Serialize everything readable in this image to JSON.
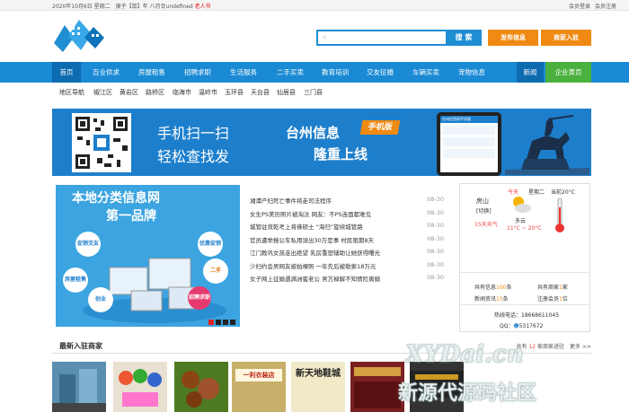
{
  "topbar": {
    "date": "2020年10月6日 星期二　庚子【鼠】年 八月廿undefined",
    "festival": "老人节",
    "login": "会员登录",
    "register": "会员注册"
  },
  "search": {
    "button": "搜 索",
    "placeholder": ""
  },
  "header_buttons": {
    "publish": "发布信息",
    "merchant": "商家入驻"
  },
  "nav": {
    "items": [
      "首页",
      "百业供求",
      "房屋租售",
      "招聘求职",
      "生活服务",
      "二手买卖",
      "教育培训",
      "交友征婚",
      "车辆买卖",
      "宠物信息"
    ],
    "news": "新闻",
    "yellow_pages": "企业黄页"
  },
  "subnav": {
    "items": [
      "地区导航",
      "椒江区",
      "黄岩区",
      "路桥区",
      "临海市",
      "温岭市",
      "玉环县",
      "天台县",
      "仙居县",
      "三门县"
    ]
  },
  "banner": {
    "line1": "手机扫一扫",
    "line2": "轻松查找发",
    "headline1": "台州信息",
    "badge": "手机版",
    "headline2": "隆重上线",
    "phone_title": "台州信息网手机版"
  },
  "slider": {
    "title1": "本地分类信息网",
    "title2": "第一品牌",
    "tags": [
      "促销交友",
      "房屋租售",
      "优惠促销",
      "二手",
      "招聘求职",
      "创业"
    ],
    "pages": [
      "1",
      "2",
      "3",
      "4"
    ]
  },
  "news": [
    {
      "title": "湘潭产妇死亡事件将走司法程序",
      "date": "08-30"
    },
    {
      "title": "女生PS美历照片被淘汰 网友：不PS连面都难见",
      "date": "08-30"
    },
    {
      "title": "城管驻敛乾考上将佛硕士 “海归”旋续城管路",
      "date": "08-30"
    },
    {
      "title": "官员遭举报公车私用误出30万是事 村民限期8天",
      "date": "08-30"
    },
    {
      "title": "江门教巩女孩走出绝望 乳房重塑辅助让她获得曙光",
      "date": "08-30"
    },
    {
      "title": "少妇约会男网友被拍裸照 一年先后被勒索18万元",
      "date": "08-30"
    },
    {
      "title": "女子网上征婚遇满洲蜜老公 男方掉解不知情险离婚",
      "date": "08-30"
    }
  ],
  "weather": {
    "today": "今天",
    "weekday": "星期二",
    "temp_label": "当前20°C",
    "city": "房山",
    "region": "[切换]",
    "forecast_link": "15天天气",
    "condition": "多云",
    "range": "11°C ~ 20°C"
  },
  "stats": {
    "info_label": "共有信息",
    "info_count": "100",
    "info_unit": "条",
    "merchant_label": "共有商家",
    "merchant_count": "1",
    "merchant_unit": "家",
    "newinfo_label": "新闻资讯",
    "newinfo_count": "15",
    "newinfo_unit": "条",
    "member_label": "注册会员",
    "member_count": "1",
    "member_unit": "位"
  },
  "contact": {
    "hotline_label": "热线电话：",
    "hotline": "18668611045",
    "qq_label": "QQ：",
    "qq": "5317672"
  },
  "section": {
    "title": "最新入驻商家",
    "count_prefix": "共有",
    "count": "12",
    "count_suffix": "家商家进驻",
    "more": "更多 >>"
  },
  "thumbnails": [
    {
      "caption": "",
      "color": "#5a8fb0"
    },
    {
      "caption": "",
      "color": "#e8e0d0"
    },
    {
      "caption": "",
      "color": "#4d7a20"
    },
    {
      "caption": "一利衣装店",
      "color": "#c8b06a"
    },
    {
      "caption": "新天地鞋城",
      "color": "#f2e9c8"
    },
    {
      "caption": "",
      "color": "#7a2020"
    },
    {
      "caption": "",
      "color": "#333333"
    }
  ],
  "watermark": {
    "line1": "XYDai.cn",
    "line2": "新源代源码社区"
  },
  "colors": {
    "nav": "#1a8ad4",
    "accent": "#f08a12",
    "yellow_pages": "#4ab13e",
    "banner": "#1d7fcc"
  }
}
